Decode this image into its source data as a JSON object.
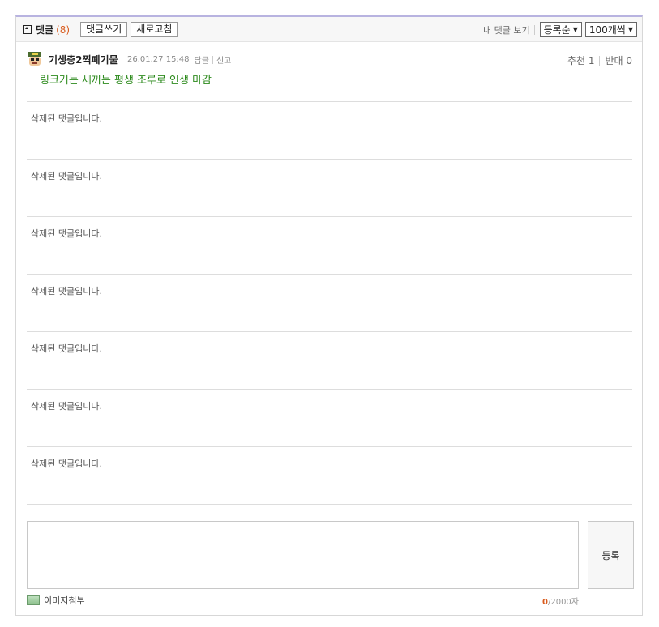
{
  "toolbar": {
    "title": "댓글",
    "count": "(8)",
    "write_label": "댓글쓰기",
    "refresh_label": "새로고침",
    "my_comments_label": "내 댓글 보기",
    "sort_value": "등록순",
    "per_page_value": "100개씩"
  },
  "comment": {
    "author": "기생충2찍폐기물",
    "time": "26.01.27 15:48",
    "reply_label": "답글",
    "report_label": "신고",
    "upvote_label": "추천 1",
    "downvote_label": "반대 0",
    "text": "링크거는 새끼는 평생 조루로 인생 마감"
  },
  "deleted_comments": [
    "삭제된 댓글입니다.",
    "삭제된 댓글입니다.",
    "삭제된 댓글입니다.",
    "삭제된 댓글입니다.",
    "삭제된 댓글입니다.",
    "삭제된 댓글입니다.",
    "삭제된 댓글입니다."
  ],
  "editor": {
    "submit_label": "등록",
    "attach_label": "이미지첨부",
    "char_count": "0",
    "char_limit": "/2000자"
  },
  "colors": {
    "accent": "#d95c1e",
    "comment_text": "#2e8b1e",
    "top_border": "#b8b3e0"
  }
}
